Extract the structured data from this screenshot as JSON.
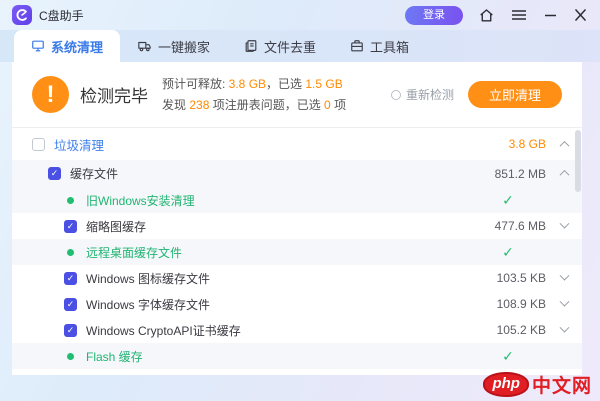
{
  "titlebar": {
    "app_title": "C盘助手",
    "login_label": "登录"
  },
  "tabs": [
    {
      "label": "系统清理",
      "icon": "disk-cleanup-icon",
      "active": true
    },
    {
      "label": "一键搬家",
      "icon": "truck-icon",
      "active": false
    },
    {
      "label": "文件去重",
      "icon": "duplicate-file-icon",
      "active": false
    },
    {
      "label": "工具箱",
      "icon": "toolbox-icon",
      "active": false
    }
  ],
  "summary": {
    "status_title": "检测完毕",
    "line1_prefix": "预计可释放: ",
    "line1_value1": "3.8 GB",
    "line1_mid": "，已选 ",
    "line1_value2": "1.5 GB",
    "line2_prefix": "发现 ",
    "line2_value1": "238",
    "line2_mid": " 项注册表问题，已选 ",
    "line2_value2": "0",
    "line2_suffix": " 项",
    "redetect_label": "重新检测",
    "clean_button_label": "立即清理"
  },
  "list": {
    "rows": [
      {
        "type": "header",
        "checked": false,
        "label": "垃圾清理",
        "size": "3.8 GB",
        "size_color": "orange",
        "chevron": "up"
      },
      {
        "type": "group",
        "checked": true,
        "label": "缓存文件",
        "size": "851.2 MB",
        "chevron": "up"
      },
      {
        "type": "done",
        "label": "旧Windows安装清理"
      },
      {
        "type": "child",
        "checked": true,
        "label": "缩略图缓存",
        "size": "477.6 MB",
        "chevron": "down"
      },
      {
        "type": "done",
        "label": "远程桌面缓存文件"
      },
      {
        "type": "child",
        "checked": true,
        "label": "Windows 图标缓存文件",
        "size": "103.5 KB",
        "chevron": "down"
      },
      {
        "type": "child",
        "checked": true,
        "label": "Windows 字体缓存文件",
        "size": "108.9 KB",
        "chevron": "down"
      },
      {
        "type": "child",
        "checked": true,
        "label": "Windows CryptoAPI证书缓存",
        "size": "105.2 KB",
        "chevron": "down"
      },
      {
        "type": "done",
        "label": "Flash 缓存"
      }
    ],
    "check_glyph": "✓"
  },
  "colors": {
    "accent_orange": "#ff9015",
    "number_orange": "#ff8a00",
    "accent_blue": "#3a7bea",
    "checkbox_indigo": "#4b50e4",
    "success_green": "#21bd70",
    "brand_purple": "#6a4ff0",
    "watermark_red": "#e01e24"
  },
  "watermark": {
    "logo": "php",
    "text": "中文网"
  }
}
